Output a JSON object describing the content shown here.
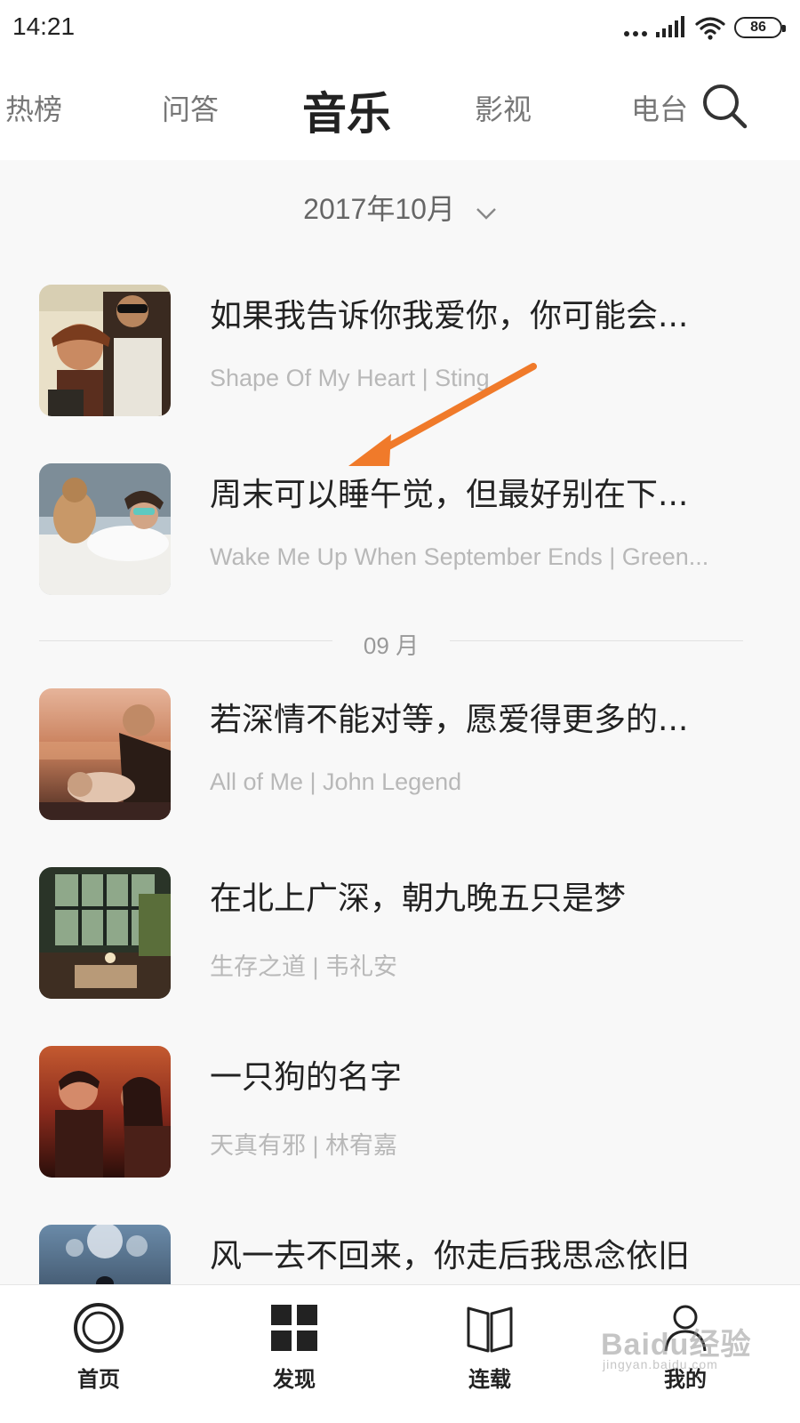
{
  "status_bar": {
    "time": "14:21",
    "battery": "86"
  },
  "top_nav": {
    "tabs": [
      "热榜",
      "问答",
      "音乐",
      "影视",
      "电台"
    ],
    "active_tab": "音乐"
  },
  "month_header": "2017年10月",
  "divider_label": "09 月",
  "items": [
    {
      "title": "如果我告诉你我爱你，你可能会...",
      "subtitle": "Shape Of My Heart | Sting"
    },
    {
      "title": "周末可以睡午觉，但最好别在下...",
      "subtitle": "Wake Me Up When September Ends | Green..."
    },
    {
      "title": "若深情不能对等，愿爱得更多的...",
      "subtitle": "All of Me | John Legend"
    },
    {
      "title": "在北上广深，朝九晚五只是梦",
      "subtitle": "生存之道 | 韦礼安"
    },
    {
      "title": "一只狗的名字",
      "subtitle": "天真有邪 | 林宥嘉"
    },
    {
      "title": "风一去不回来，你走后我思念依旧",
      "subtitle": ""
    }
  ],
  "bottom_nav": [
    {
      "label": "首页",
      "icon": "home-circle-icon"
    },
    {
      "label": "发现",
      "icon": "grid-icon"
    },
    {
      "label": "连载",
      "icon": "book-icon"
    },
    {
      "label": "我的",
      "icon": "person-icon"
    }
  ],
  "watermark": {
    "main": "Baidu经验",
    "sub": "jingyan.baidu.com"
  },
  "colors": {
    "annotation_arrow": "#f07a2a",
    "subtitle_gray": "#b8b8b8"
  }
}
